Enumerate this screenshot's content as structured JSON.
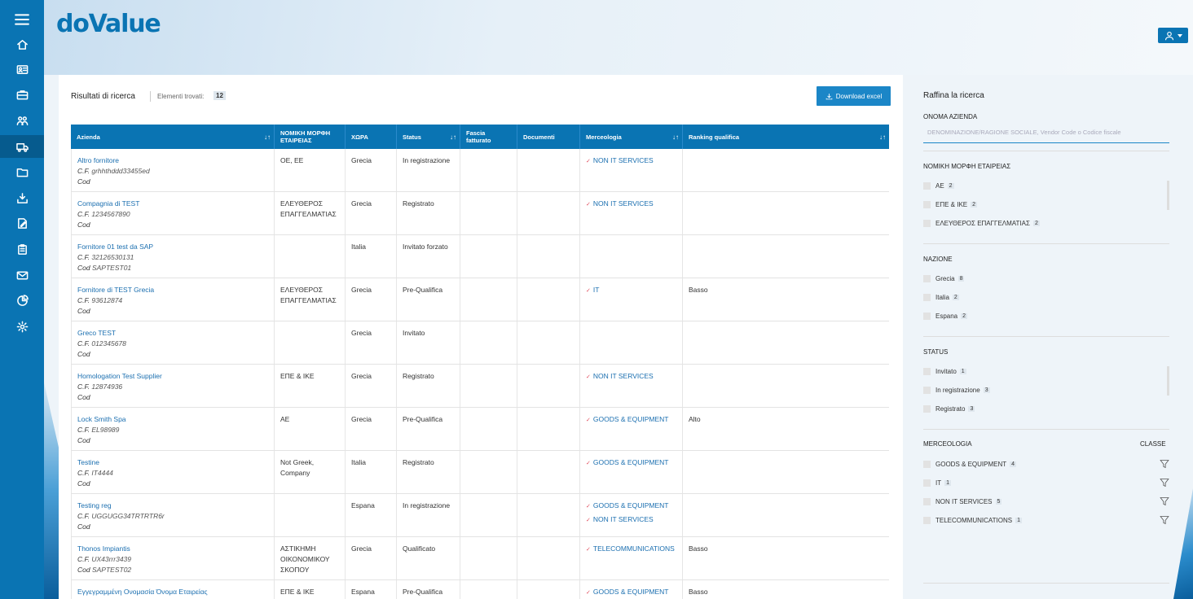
{
  "brand": {
    "logo_text": "doValue"
  },
  "results": {
    "title": "Risultati di ricerca",
    "count_label": "Elementi trovati:",
    "count": "12",
    "download_label": "Download excel"
  },
  "table": {
    "headers": [
      {
        "label": "Azienda",
        "sort": "↓↑"
      },
      {
        "label": "ΝΟΜΙΚΗ ΜΟΡΦΗ ΕΤΑΙΡΕΙΑΣ",
        "sort": ""
      },
      {
        "label": "ΧΩΡΑ",
        "sort": ""
      },
      {
        "label": "Status",
        "sort": "↓↑"
      },
      {
        "label": "Fascia fatturato",
        "sort": ""
      },
      {
        "label": "Documenti",
        "sort": ""
      },
      {
        "label": "Merceologia",
        "sort": "↓↑"
      },
      {
        "label": "Ranking qualifica",
        "sort": "↓↑"
      }
    ],
    "cf_label": "C.F.",
    "cod_label": "Cod",
    "rows": [
      {
        "name": "Altro fornitore",
        "cf": "grhhthddd33455ed",
        "cod": "",
        "legal": "OE, EE",
        "country": "Grecia",
        "status": "In registrazione",
        "merc": [
          "NON IT SERVICES"
        ],
        "rank": ""
      },
      {
        "name": "Compagnia di TEST",
        "cf": "1234567890",
        "cod": "",
        "legal": "ΕΛΕΥΘΕΡΟΣ ΕΠΑΓΓΕΛΜΑΤΙΑΣ",
        "country": "Grecia",
        "status": "Registrato",
        "merc": [
          "NON IT SERVICES"
        ],
        "rank": ""
      },
      {
        "name": "Fornitore 01 test da SAP",
        "cf": "32126530131",
        "cod": "SAPTEST01",
        "legal": "",
        "country": "Italia",
        "status": "Invitato forzato",
        "merc": [],
        "rank": ""
      },
      {
        "name": "Fornitore di TEST Grecia",
        "cf": "93612874",
        "cod": "",
        "legal": "ΕΛΕΥΘΕΡΟΣ ΕΠΑΓΓΕΛΜΑΤΙΑΣ",
        "country": "Grecia",
        "status": "Pre-Qualifica",
        "merc": [
          "IT"
        ],
        "rank": "Basso"
      },
      {
        "name": "Greco TEST",
        "cf": "012345678",
        "cod": "",
        "legal": "",
        "country": "Grecia",
        "status": "Invitato",
        "merc": [],
        "rank": ""
      },
      {
        "name": "Homologation Test Supplier",
        "cf": "12874936",
        "cod": "",
        "legal": "ΕΠΕ & ΙΚΕ",
        "country": "Grecia",
        "status": "Registrato",
        "merc": [
          "NON IT SERVICES"
        ],
        "rank": ""
      },
      {
        "name": "Lock Smith Spa",
        "cf": "EL98989",
        "cod": "",
        "legal": "ΑΕ",
        "country": "Grecia",
        "status": "Pre-Qualifica",
        "merc": [
          "GOODS & EQUIPMENT"
        ],
        "rank": "Alto"
      },
      {
        "name": "Testine",
        "cf": "IT4444",
        "cod": "",
        "legal": "Not Greek, Company",
        "country": "Italia",
        "status": "Registrato",
        "merc": [
          "GOODS & EQUIPMENT"
        ],
        "rank": ""
      },
      {
        "name": "Testing reg",
        "cf": "UGGUGG34TRTRTR6r",
        "cod": "",
        "legal": "",
        "country": "Espana",
        "status": "In registrazione",
        "merc": [
          "GOODS & EQUIPMENT",
          "NON IT SERVICES"
        ],
        "rank": ""
      },
      {
        "name": "Thonos Impiantis",
        "cf": "UX43rrr3439",
        "cod": "SAPTEST02",
        "legal": "ΑΣΤΙΚΗΜΗ ΟΙΚΟΝΟΜΙΚΟΥ ΣΚΟΠΟΥ",
        "country": "Grecia",
        "status": "Qualificato",
        "merc": [
          "TELECOMMUNICATIONS"
        ],
        "rank": "Basso"
      },
      {
        "name": "Εγγεγραμμένη Ονομασία Όνομα Εταιρείας",
        "cf": "",
        "cod": "",
        "legal": "ΕΠΕ & ΙΚΕ",
        "country": "Espana",
        "status": "Pre-Qualifica",
        "merc": [
          "GOODS & EQUIPMENT"
        ],
        "rank": "Basso"
      }
    ]
  },
  "filters": {
    "title": "Raffina la ricerca",
    "name_label": "ONOMA AZIENDA",
    "name_placeholder": "DENOMINAZIONE/RAGIONE SOCIALE, Vendor Code o Codice fiscale",
    "legal_label": "ΝΟΜΙΚΗ ΜΟΡΦΗ ΕΤΑΙΡΕΙΑΣ",
    "legal_items": [
      {
        "label": "ΑΕ",
        "count": "2"
      },
      {
        "label": "ΕΠΕ & ΙΚΕ",
        "count": "2"
      },
      {
        "label": "ΕΛΕΥΘΕΡΟΣ ΕΠΑΓΓΕΛΜΑΤΙΑΣ",
        "count": "2"
      }
    ],
    "nation_label": "NAZIONE",
    "nation_items": [
      {
        "label": "Grecia",
        "count": "8"
      },
      {
        "label": "Italia",
        "count": "2"
      },
      {
        "label": "Espana",
        "count": "2"
      }
    ],
    "status_label": "STATUS",
    "status_items": [
      {
        "label": "Invitato",
        "count": "1"
      },
      {
        "label": "In registrazione",
        "count": "3"
      },
      {
        "label": "Registrato",
        "count": "3"
      }
    ],
    "merc_label": "MERCEOLOGIA",
    "classe_label": "CLASSE",
    "merc_items": [
      {
        "label": "GOODS & EQUIPMENT",
        "count": "4"
      },
      {
        "label": "IT",
        "count": "1"
      },
      {
        "label": "NON IT SERVICES",
        "count": "5"
      },
      {
        "label": "TELECOMMUNICATIONS",
        "count": "1"
      }
    ]
  },
  "icons": {
    "sidebar": [
      "menu-icon",
      "home-icon",
      "id-card-icon",
      "briefcase-icon",
      "users-icon",
      "truck-icon",
      "folder-icon",
      "download-box-icon",
      "edit-doc-icon",
      "clipboard-icon",
      "mail-icon",
      "pie-chart-icon",
      "gear-icon"
    ],
    "user": "user-icon",
    "download": "download-icon",
    "filter": "funnel-icon"
  },
  "colors": {
    "primary": "#0a74b3",
    "sidebar_active": "#065b8e",
    "link": "#1b6fb0",
    "check": "#e04b5b"
  }
}
